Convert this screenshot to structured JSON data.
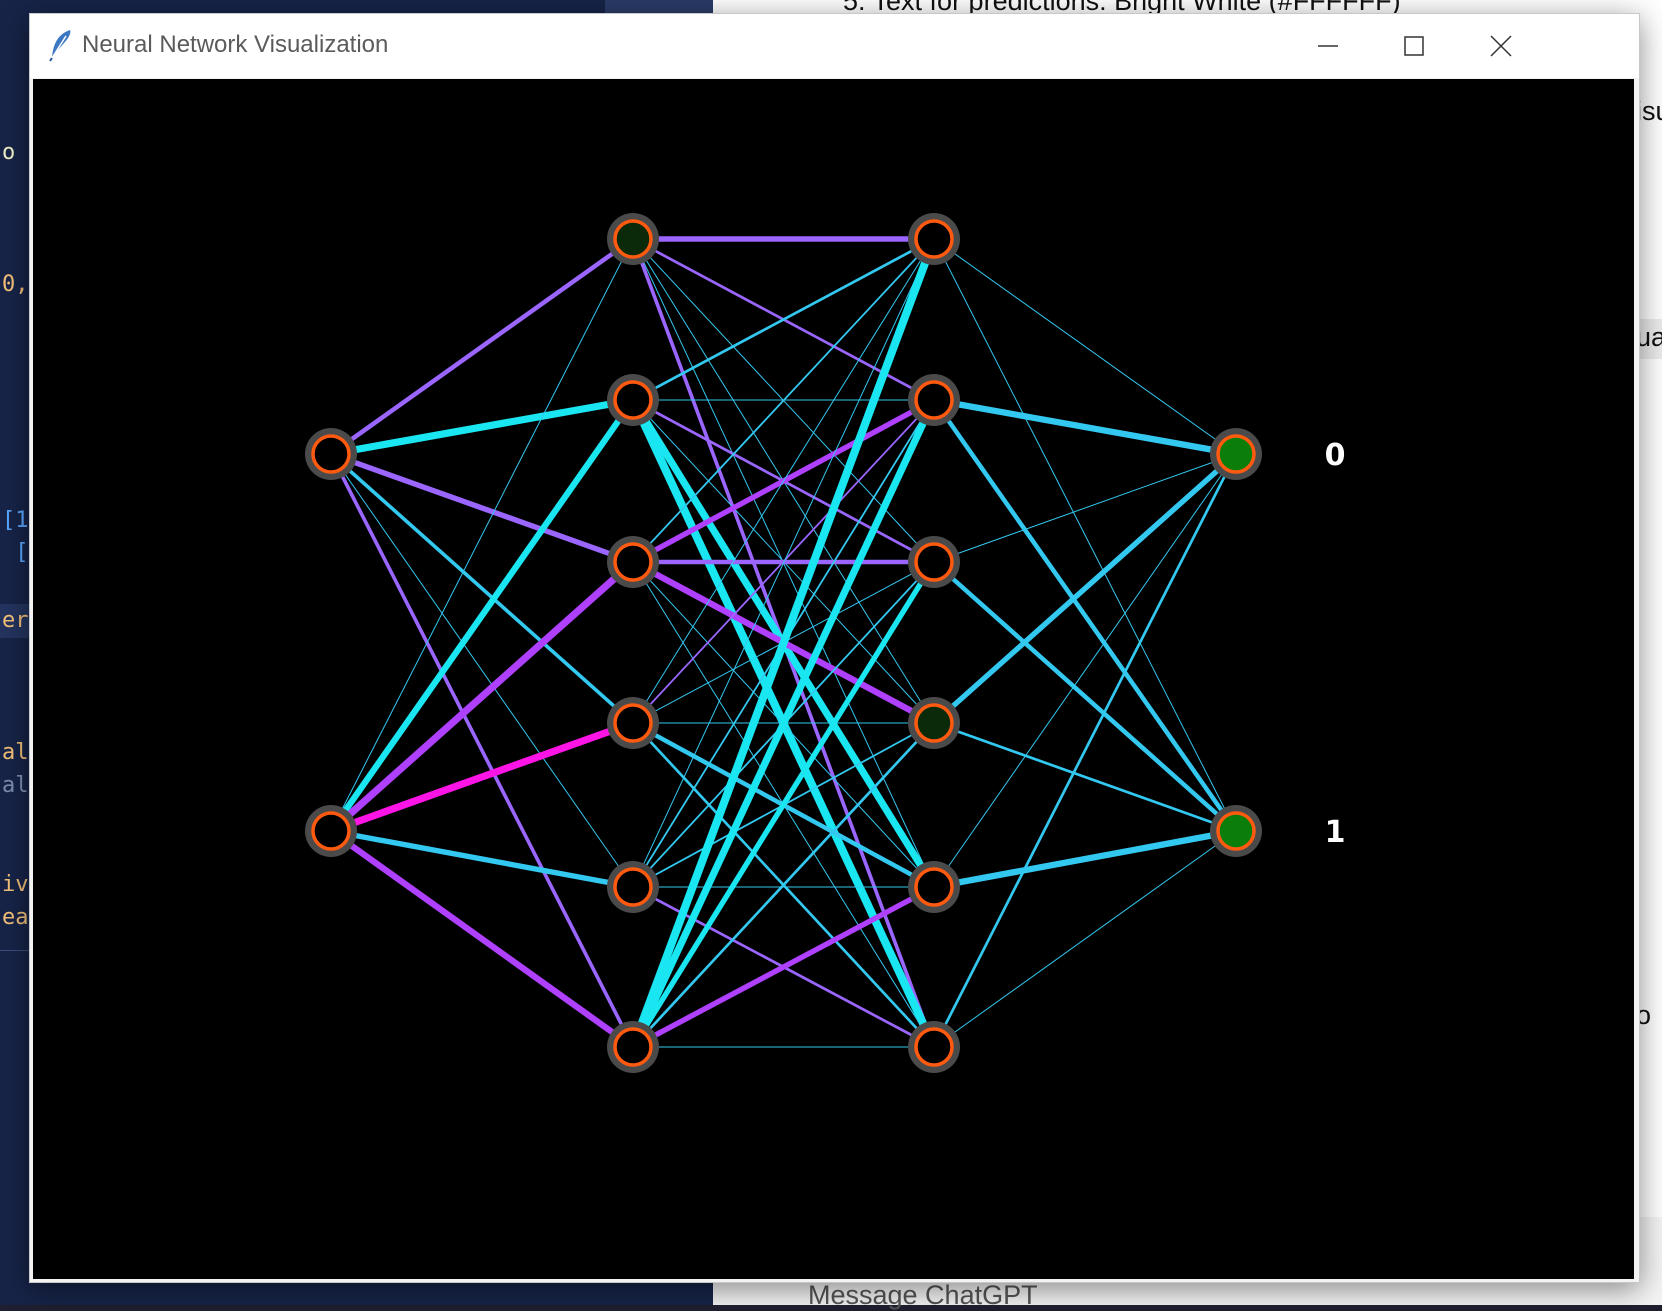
{
  "window": {
    "title": "Neural Network Visualization"
  },
  "controls": {
    "minimize": "minimize-icon",
    "maximize": "maximize-icon",
    "close": "close-icon"
  },
  "colors": {
    "canvas_bg": "#000000",
    "node_fill": "#000000",
    "node_fill_dim_green": "#0a2a0a",
    "output_fill": "#0a7d0a",
    "node_ring": "#ff5a0f",
    "node_halo": "#4a4a4a",
    "weight_cyan": "#19e6f0",
    "weight_sky": "#33c8f0",
    "weight_violet": "#9a66ff",
    "weight_purple": "#b040ff",
    "weight_magenta": "#ff14e6"
  },
  "network": {
    "layers": [
      {
        "name": "input",
        "nodes": [
          {
            "fill": "black"
          },
          {
            "fill": "black"
          }
        ]
      },
      {
        "name": "hidden1",
        "nodes": [
          {
            "fill": "dim"
          },
          {
            "fill": "black"
          },
          {
            "fill": "black"
          },
          {
            "fill": "black"
          },
          {
            "fill": "black"
          },
          {
            "fill": "black"
          }
        ]
      },
      {
        "name": "hidden2",
        "nodes": [
          {
            "fill": "black"
          },
          {
            "fill": "black"
          },
          {
            "fill": "black"
          },
          {
            "fill": "dim"
          },
          {
            "fill": "black"
          },
          {
            "fill": "black"
          }
        ]
      },
      {
        "name": "output",
        "nodes": [
          {
            "fill": "green"
          },
          {
            "fill": "green"
          }
        ]
      }
    ],
    "output_labels": [
      "0",
      "1"
    ],
    "weights": [
      {
        "layer": 0,
        "from": 0,
        "to": 0,
        "color": "violet",
        "strength": 5
      },
      {
        "layer": 0,
        "from": 0,
        "to": 1,
        "color": "cyan",
        "strength": 8
      },
      {
        "layer": 0,
        "from": 0,
        "to": 2,
        "color": "violet",
        "strength": 6
      },
      {
        "layer": 0,
        "from": 0,
        "to": 3,
        "color": "sky",
        "strength": 4
      },
      {
        "layer": 0,
        "from": 0,
        "to": 4,
        "color": "sky",
        "strength": 1
      },
      {
        "layer": 0,
        "from": 0,
        "to": 5,
        "color": "violet",
        "strength": 4
      },
      {
        "layer": 0,
        "from": 1,
        "to": 0,
        "color": "sky",
        "strength": 1
      },
      {
        "layer": 0,
        "from": 1,
        "to": 1,
        "color": "cyan",
        "strength": 7
      },
      {
        "layer": 0,
        "from": 1,
        "to": 2,
        "color": "purple",
        "strength": 8
      },
      {
        "layer": 0,
        "from": 1,
        "to": 3,
        "color": "magenta",
        "strength": 8
      },
      {
        "layer": 0,
        "from": 1,
        "to": 4,
        "color": "sky",
        "strength": 6
      },
      {
        "layer": 0,
        "from": 1,
        "to": 5,
        "color": "purple",
        "strength": 7
      },
      {
        "layer": 1,
        "from": 0,
        "to": 0,
        "color": "violet",
        "strength": 6
      },
      {
        "layer": 1,
        "from": 0,
        "to": 1,
        "color": "violet",
        "strength": 3
      },
      {
        "layer": 1,
        "from": 0,
        "to": 2,
        "color": "sky",
        "strength": 1
      },
      {
        "layer": 1,
        "from": 0,
        "to": 3,
        "color": "sky",
        "strength": 1
      },
      {
        "layer": 1,
        "from": 0,
        "to": 4,
        "color": "sky",
        "strength": 1
      },
      {
        "layer": 1,
        "from": 0,
        "to": 5,
        "color": "violet",
        "strength": 4
      },
      {
        "layer": 1,
        "from": 1,
        "to": 0,
        "color": "sky",
        "strength": 3
      },
      {
        "layer": 1,
        "from": 1,
        "to": 1,
        "color": "sky",
        "strength": 1
      },
      {
        "layer": 1,
        "from": 1,
        "to": 2,
        "color": "violet",
        "strength": 3
      },
      {
        "layer": 1,
        "from": 1,
        "to": 3,
        "color": "sky",
        "strength": 1
      },
      {
        "layer": 1,
        "from": 1,
        "to": 4,
        "color": "cyan",
        "strength": 8
      },
      {
        "layer": 1,
        "from": 1,
        "to": 5,
        "color": "cyan",
        "strength": 9
      },
      {
        "layer": 1,
        "from": 2,
        "to": 0,
        "color": "sky",
        "strength": 2
      },
      {
        "layer": 1,
        "from": 2,
        "to": 1,
        "color": "purple",
        "strength": 6
      },
      {
        "layer": 1,
        "from": 2,
        "to": 2,
        "color": "violet",
        "strength": 5
      },
      {
        "layer": 1,
        "from": 2,
        "to": 3,
        "color": "purple",
        "strength": 7
      },
      {
        "layer": 1,
        "from": 2,
        "to": 4,
        "color": "sky",
        "strength": 1
      },
      {
        "layer": 1,
        "from": 2,
        "to": 5,
        "color": "sky",
        "strength": 1
      },
      {
        "layer": 1,
        "from": 3,
        "to": 0,
        "color": "sky",
        "strength": 1
      },
      {
        "layer": 1,
        "from": 3,
        "to": 1,
        "color": "violet",
        "strength": 2
      },
      {
        "layer": 1,
        "from": 3,
        "to": 2,
        "color": "sky",
        "strength": 1
      },
      {
        "layer": 1,
        "from": 3,
        "to": 3,
        "color": "sky",
        "strength": 1
      },
      {
        "layer": 1,
        "from": 3,
        "to": 4,
        "color": "sky",
        "strength": 5
      },
      {
        "layer": 1,
        "from": 3,
        "to": 5,
        "color": "sky",
        "strength": 3
      },
      {
        "layer": 1,
        "from": 4,
        "to": 0,
        "color": "sky",
        "strength": 1
      },
      {
        "layer": 1,
        "from": 4,
        "to": 1,
        "color": "sky",
        "strength": 2
      },
      {
        "layer": 1,
        "from": 4,
        "to": 2,
        "color": "sky",
        "strength": 2
      },
      {
        "layer": 1,
        "from": 4,
        "to": 3,
        "color": "sky",
        "strength": 2
      },
      {
        "layer": 1,
        "from": 4,
        "to": 4,
        "color": "sky",
        "strength": 1
      },
      {
        "layer": 1,
        "from": 4,
        "to": 5,
        "color": "violet",
        "strength": 3
      },
      {
        "layer": 1,
        "from": 5,
        "to": 0,
        "color": "cyan",
        "strength": 9
      },
      {
        "layer": 1,
        "from": 5,
        "to": 1,
        "color": "cyan",
        "strength": 8
      },
      {
        "layer": 1,
        "from": 5,
        "to": 2,
        "color": "cyan",
        "strength": 6
      },
      {
        "layer": 1,
        "from": 5,
        "to": 3,
        "color": "sky",
        "strength": 3
      },
      {
        "layer": 1,
        "from": 5,
        "to": 4,
        "color": "purple",
        "strength": 6
      },
      {
        "layer": 1,
        "from": 5,
        "to": 5,
        "color": "sky",
        "strength": 1
      },
      {
        "layer": 2,
        "from": 0,
        "to": 0,
        "color": "sky",
        "strength": 1
      },
      {
        "layer": 2,
        "from": 0,
        "to": 1,
        "color": "sky",
        "strength": 1
      },
      {
        "layer": 2,
        "from": 1,
        "to": 0,
        "color": "sky",
        "strength": 7
      },
      {
        "layer": 2,
        "from": 1,
        "to": 1,
        "color": "sky",
        "strength": 5
      },
      {
        "layer": 2,
        "from": 2,
        "to": 0,
        "color": "sky",
        "strength": 1
      },
      {
        "layer": 2,
        "from": 2,
        "to": 1,
        "color": "sky",
        "strength": 5
      },
      {
        "layer": 2,
        "from": 3,
        "to": 0,
        "color": "sky",
        "strength": 6
      },
      {
        "layer": 2,
        "from": 3,
        "to": 1,
        "color": "sky",
        "strength": 3
      },
      {
        "layer": 2,
        "from": 4,
        "to": 0,
        "color": "sky",
        "strength": 1
      },
      {
        "layer": 2,
        "from": 4,
        "to": 1,
        "color": "sky",
        "strength": 7
      },
      {
        "layer": 2,
        "from": 5,
        "to": 0,
        "color": "sky",
        "strength": 3
      },
      {
        "layer": 2,
        "from": 5,
        "to": 1,
        "color": "sky",
        "strength": 1
      }
    ]
  },
  "background": {
    "editor_fragments": [
      {
        "text": "o",
        "color": "#f0f0c8"
      },
      {
        "text": "0,",
        "color": "#f5c27a"
      },
      {
        "text": "[1",
        "color": "#5aa8ff"
      },
      {
        "text": " [",
        "color": "#5aa8ff"
      },
      {
        "text": "er",
        "color": "#f5c27a"
      },
      {
        "text": "al",
        "color": "#f5c27a"
      },
      {
        "text": "al",
        "color": "#7f8fb0"
      },
      {
        "text": "iv",
        "color": "#f5c27a"
      },
      {
        "text": "ea",
        "color": "#f5c27a"
      }
    ],
    "chat_fragments": [
      {
        "text": "5.  Text for predictions: Bright White (#FFFFFF)"
      },
      {
        "text": "isu"
      },
      {
        "text": "ua"
      },
      {
        "text": "o"
      },
      {
        "text": "Message ChatGPT"
      }
    ]
  }
}
